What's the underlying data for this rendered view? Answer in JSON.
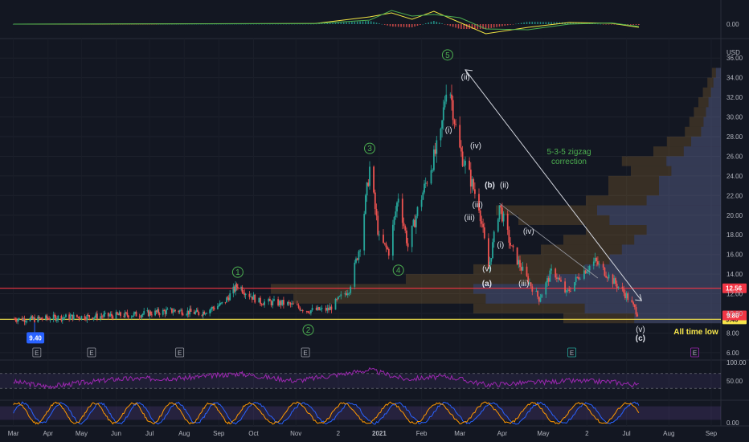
{
  "chart_data": [
    {
      "type": "line",
      "panel": "macd",
      "ytick_labels": [
        "0.00"
      ],
      "series": [
        {
          "color": "#f0e442",
          "x": [
            "2020-03-01",
            "2020-06-01",
            "2020-08-15",
            "2020-11-15",
            "2020-12-25",
            "2021-01-10",
            "2021-01-25",
            "2021-02-10",
            "2021-03-01",
            "2021-03-20",
            "2021-04-20",
            "2021-05-20",
            "2021-06-20",
            "2021-07-10"
          ],
          "values": [
            0.0,
            0.02,
            0.05,
            0.08,
            0.9,
            1.4,
            0.6,
            1.6,
            0.2,
            -1.2,
            -0.4,
            0.2,
            0.1,
            -0.4
          ]
        },
        {
          "color": "#4caf50",
          "x": [
            "2020-03-01",
            "2020-06-01",
            "2020-08-15",
            "2020-11-15",
            "2020-12-25",
            "2021-01-10",
            "2021-01-25",
            "2021-02-10",
            "2021-03-01",
            "2021-03-20",
            "2021-04-20",
            "2021-05-20",
            "2021-06-20",
            "2021-07-10"
          ],
          "values": [
            0.0,
            0.03,
            0.04,
            0.06,
            0.5,
            1.7,
            1.0,
            1.2,
            0.8,
            -0.6,
            -0.7,
            0.0,
            0.15,
            -0.3
          ]
        }
      ]
    },
    {
      "type": "candlestick",
      "panel": "price",
      "currency": "USD",
      "ytick_labels": [
        "6.00",
        "8.00",
        "10.00",
        "12.00",
        "14.00",
        "16.00",
        "18.00",
        "20.00",
        "22.00",
        "24.00",
        "26.00",
        "28.00",
        "30.00",
        "32.00",
        "34.00",
        "36.00"
      ],
      "ylim": [
        5.5,
        37
      ],
      "ohlc_path": [
        [
          "2020-03-01",
          9.45
        ],
        [
          "2020-03-20",
          9.4
        ],
        [
          "2020-04-10",
          9.6
        ],
        [
          "2020-05-15",
          9.7
        ],
        [
          "2020-06-20",
          9.9
        ],
        [
          "2020-07-25",
          10.3
        ],
        [
          "2020-08-15",
          10.0
        ],
        [
          "2020-09-05",
          11.0
        ],
        [
          "2020-09-18",
          12.9
        ],
        [
          "2020-10-05",
          11.2
        ],
        [
          "2020-10-25",
          11.0
        ],
        [
          "2020-11-10",
          10.3
        ],
        [
          "2020-11-25",
          10.4
        ],
        [
          "2020-12-10",
          12.5
        ],
        [
          "2020-12-18",
          17.0
        ],
        [
          "2020-12-25",
          24.8
        ],
        [
          "2021-01-01",
          17.5
        ],
        [
          "2021-01-08",
          16.3
        ],
        [
          "2021-01-15",
          22.0
        ],
        [
          "2021-01-22",
          16.8
        ],
        [
          "2021-01-30",
          21.0
        ],
        [
          "2021-02-08",
          25.0
        ],
        [
          "2021-02-15",
          28.0
        ],
        [
          "2021-02-20",
          34.5
        ],
        [
          "2021-02-28",
          27.0
        ],
        [
          "2021-03-08",
          24.0
        ],
        [
          "2021-03-15",
          21.0
        ],
        [
          "2021-03-22",
          14.5
        ],
        [
          "2021-03-30",
          21.0
        ],
        [
          "2021-04-08",
          16.5
        ],
        [
          "2021-04-18",
          13.8
        ],
        [
          "2021-04-28",
          11.5
        ],
        [
          "2021-05-08",
          14.5
        ],
        [
          "2021-05-18",
          12.0
        ],
        [
          "2021-05-28",
          14.0
        ],
        [
          "2021-06-08",
          15.3
        ],
        [
          "2021-06-20",
          13.5
        ],
        [
          "2021-07-01",
          11.8
        ],
        [
          "2021-07-10",
          9.8
        ]
      ],
      "horizontal_lines": [
        {
          "value": 12.56,
          "color": "#f23645",
          "label": "12.56"
        },
        {
          "value": 9.4,
          "color": "#f7e64b",
          "label": "9.40"
        }
      ],
      "last_price": "9.80",
      "low_badge": "9.40",
      "wave_labels": [
        "1",
        "2",
        "3",
        "4",
        "5"
      ],
      "wave_labels_secondary": [
        "(i)",
        "(ii)",
        "(iii)",
        "(iv)",
        "(v)",
        "(a)",
        "(b)",
        "(c)"
      ],
      "annotations": [
        "5-3-5 zigzag",
        "correction",
        "All time low"
      ],
      "earnings_markers": [
        "E",
        "E",
        "E",
        "E",
        "E",
        "E"
      ]
    },
    {
      "type": "line",
      "panel": "rsi",
      "ytick_labels": [
        "100.00",
        "50.00"
      ],
      "ylim": [
        0,
        100
      ],
      "series": [
        {
          "color": "#9c27b0",
          "x": [
            "2020-03-01",
            "2020-04-01",
            "2020-06-01",
            "2020-08-01",
            "2020-09-20",
            "2020-11-01",
            "2020-12-25",
            "2021-01-20",
            "2021-02-20",
            "2021-03-20",
            "2021-04-20",
            "2021-05-20",
            "2021-06-20",
            "2021-07-10"
          ],
          "values": [
            48,
            35,
            55,
            58,
            70,
            50,
            80,
            55,
            62,
            40,
            45,
            50,
            48,
            38
          ]
        }
      ]
    },
    {
      "type": "line",
      "panel": "stoch_rsi",
      "ytick_labels": [
        "0.00"
      ],
      "series": [
        {
          "color": "#2962ff",
          "x": [],
          "values": []
        },
        {
          "color": "#ff9800",
          "x": [],
          "values": []
        }
      ]
    }
  ],
  "x_axis": {
    "labels": [
      "Mar",
      "Apr",
      "May",
      "Jun",
      "Jul",
      "Aug",
      "Sep",
      "Oct",
      "Nov",
      "2",
      "2021",
      "Feb",
      "Mar",
      "Apr",
      "May",
      "2",
      "Jul",
      "Aug",
      "Sep"
    ]
  }
}
